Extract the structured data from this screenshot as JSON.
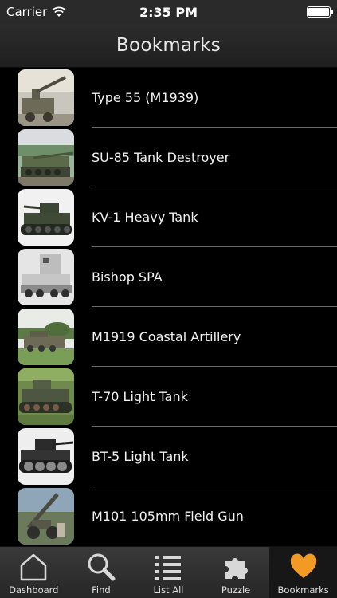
{
  "status_bar": {
    "carrier": "Carrier",
    "time": "2:35 PM",
    "battery_level": 1.0
  },
  "nav": {
    "title": "Bookmarks"
  },
  "bookmarks": [
    {
      "label": "Type 55 (M1939)"
    },
    {
      "label": "SU-85 Tank Destroyer"
    },
    {
      "label": "KV-1 Heavy Tank"
    },
    {
      "label": "Bishop SPA"
    },
    {
      "label": "M1919 Coastal Artillery"
    },
    {
      "label": "T-70 Light Tank"
    },
    {
      "label": "BT-5 Light Tank"
    },
    {
      "label": "M101 105mm Field Gun"
    }
  ],
  "tab_bar": {
    "active": "Bookmarks",
    "tabs": [
      {
        "label": "Dashboard",
        "icon": "house-icon"
      },
      {
        "label": "Find",
        "icon": "magnifier-icon"
      },
      {
        "label": "List All",
        "icon": "list-icon"
      },
      {
        "label": "Puzzle",
        "icon": "puzzle-icon"
      },
      {
        "label": "Bookmarks",
        "icon": "heart-icon"
      }
    ]
  },
  "colors": {
    "accent": "#f39a24",
    "background": "#000000",
    "separator": "#6a6a6a"
  }
}
